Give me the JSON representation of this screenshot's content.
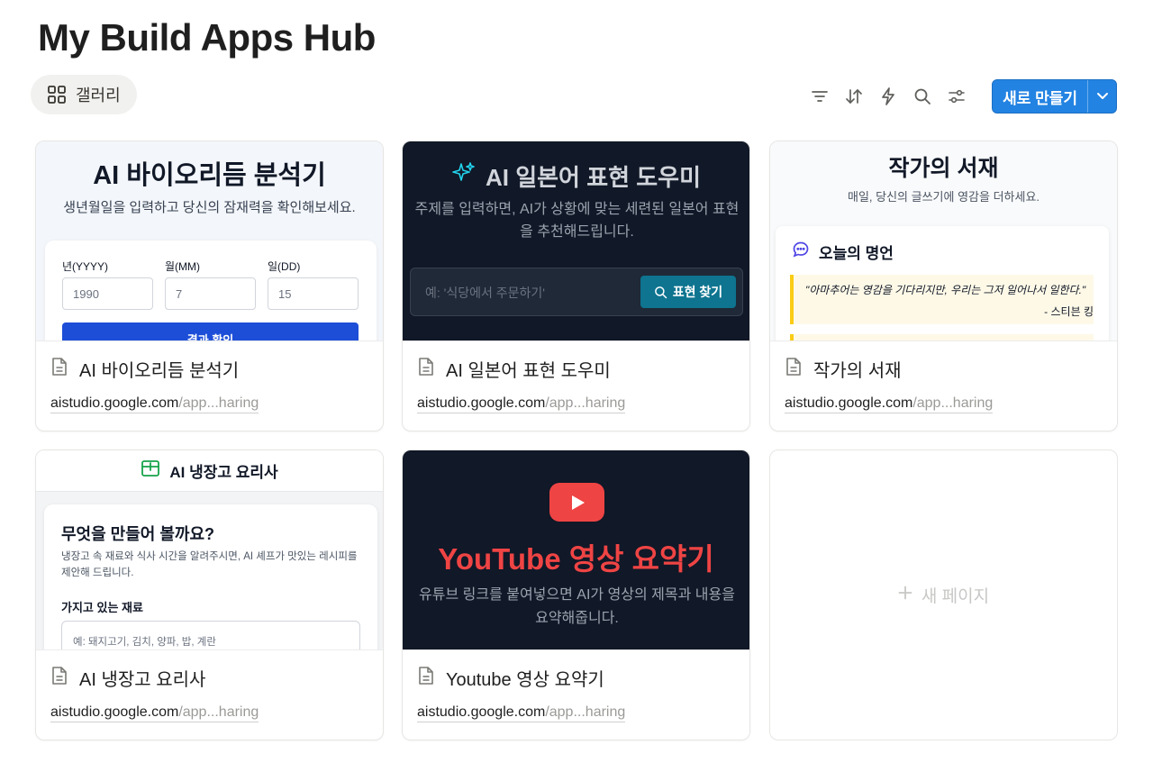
{
  "page": {
    "title": "My Build Apps Hub"
  },
  "view_tab": {
    "label": "갤러리",
    "icon": "grid-icon"
  },
  "toolbar": {
    "icons": [
      "filter-icon",
      "sort-icon",
      "lightning-icon",
      "search-icon",
      "settings-sliders-icon"
    ],
    "new_button_label": "새로 만들기",
    "accent_color": "#2383e2"
  },
  "cards": [
    {
      "title": "AI 바이오리듬 분석기",
      "url_main": "aistudio.google.com",
      "url_rest": "/app...haring",
      "preview": {
        "heading": "AI 바이오리듬 분석기",
        "subtitle": "생년월일을 입력하고 당신의 잠재력을 확인해보세요.",
        "year_label": "년(YYYY)",
        "month_label": "월(MM)",
        "day_label": "일(DD)",
        "year_placeholder": "1990",
        "month_placeholder": "7",
        "day_placeholder": "15",
        "submit_label": "결과 확인"
      }
    },
    {
      "title": "AI 일본어 표현 도우미",
      "url_main": "aistudio.google.com",
      "url_rest": "/app...haring",
      "preview": {
        "heading": "AI 일본어 표현 도우미",
        "subtitle": "주제를 입력하면, AI가 상황에 맞는 세련된 일본어 표현을 추천해드립니다.",
        "placeholder": "예: '식당에서 주문하기'",
        "button_label": "표현 찾기"
      }
    },
    {
      "title": "작가의 서재",
      "url_main": "aistudio.google.com",
      "url_rest": "/app...haring",
      "preview": {
        "heading": "작가의 서재",
        "subtitle": "매일, 당신의 글쓰기에 영감을 더하세요.",
        "panel_title": "오늘의 명언",
        "quote": "\"아마추어는 영감을 기다리지만, 우리는 그저 일어나서 일한다.\"",
        "author": "- 스티븐 킹"
      }
    },
    {
      "title": "AI 냉장고 요리사",
      "url_main": "aistudio.google.com",
      "url_rest": "/app...haring",
      "preview": {
        "header": "AI 냉장고 요리사",
        "panel_title": "무엇을 만들어 볼까요?",
        "description": "냉장고 속 재료와 식사 시간을 알려주시면, AI 셰프가 맛있는 레시피를 제안해 드립니다.",
        "field_label": "가지고 있는 재료",
        "placeholder": "예: 돼지고기, 김치, 양파, 밥, 계란"
      }
    },
    {
      "title": "Youtube 영상 요약기",
      "url_main": "aistudio.google.com",
      "url_rest": "/app...haring",
      "preview": {
        "heading": "YouTube 영상 요약기",
        "subtitle": "유튜브 링크를 붙여넣으면 AI가 영상의 제목과 내용을 요약해줍니다."
      }
    }
  ],
  "new_page": {
    "label": "새 페이지"
  }
}
